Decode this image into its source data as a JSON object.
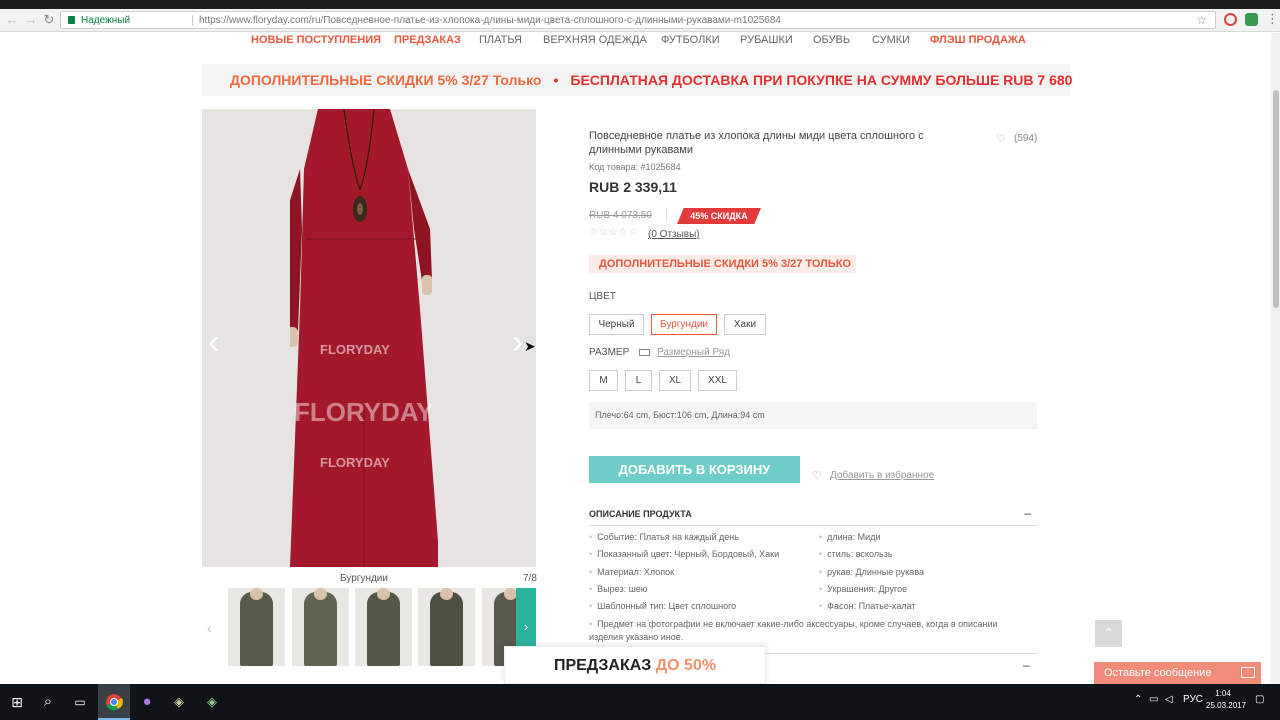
{
  "browser": {
    "secure_label": "Надежный",
    "url": "https://www.floryday.com/ru/Повседневное-платье-из-хлопока-длины-миди-цвета-сплошного-с-длинными-рукавами-m1025684"
  },
  "nav": {
    "items": [
      "НОВЫЕ ПОСТУПЛЕНИЯ",
      "ПРЕДЗАКАЗ",
      "ПЛАТЬЯ",
      "ВЕРХНЯЯ ОДЕЖДА",
      "ФУТБОЛКИ",
      "РУБАШКИ",
      "ОБУВЬ",
      "СУМКИ",
      "ФЛЭШ ПРОДАЖА"
    ]
  },
  "banner": {
    "left": "ДОПОЛНИТЕЛЬНЫЕ СКИДКИ 5% 3/27 Только",
    "dot": "•",
    "right": "БЕСПЛАТНАЯ ДОСТАВКА ПРИ ПОКУПКЕ НА СУММУ БОЛЬШЕ RUB 7 680"
  },
  "gallery": {
    "watermark": "FLORYDAY",
    "caption": "Бургундии",
    "counter": "7/8"
  },
  "product": {
    "title": "Повседневное платье из хлопока длины миди цвета сплошного с длинными рукавами",
    "wish_count": "(594)",
    "code": "Код товара: #1025684",
    "price": "RUB 2 339,11",
    "old_price": "RUB 4 073,50",
    "discount": "45% СКИДКА",
    "reviews": "(0 Отзывы)",
    "promo": "ДОПОЛНИТЕЛЬНЫЕ СКИДКИ 5% 3/27 ТОЛЬКО",
    "color_label": "ЦВЕТ",
    "colors": [
      "Черный",
      "Бургундии",
      "Хаки"
    ],
    "size_label": "РАЗМЕР",
    "size_chart": "Размерный Ряд",
    "sizes": [
      "M",
      "L",
      "XL",
      "XXL"
    ],
    "measurements": "Плечо:64 cm, Бюст:106 cm, Длина:94 cm",
    "add_to_cart": "ДОБАВИТЬ В КОРЗИНУ",
    "add_to_favorites": "Добавить в избранное"
  },
  "description": {
    "heading": "ОПИСАНИЕ ПРОДУКТА",
    "toggle": "–",
    "left": [
      "Событие: Платья на каждый день",
      "Показанный цвет: Черный, Бордовый, Хаки",
      "Материал: Хлопок",
      "Вырез: шею",
      "Шаблонный тип: Цвет сплошного"
    ],
    "right": [
      "длина: Миди",
      "стиль: вскользь",
      "рукав: Длинные рукава",
      "Украшения: Другое",
      "Фасон: Платье-халат"
    ],
    "note": "Предмет на фотографии не включает какие-либо аксессуары, кроме случаев, когда в описании изделия указано иное."
  },
  "floating": {
    "preorder": "ПРЕДЗАКАЗ",
    "preorder_pct": "ДО 50%",
    "chat": "Оставьте сообщение"
  },
  "taskbar": {
    "lang": "РУС",
    "time": "1:04",
    "date": "25.03.2017"
  },
  "colors": {
    "accent_red": "#e8583c",
    "teal": "#6fcdc7",
    "dress": "#a3182a"
  }
}
